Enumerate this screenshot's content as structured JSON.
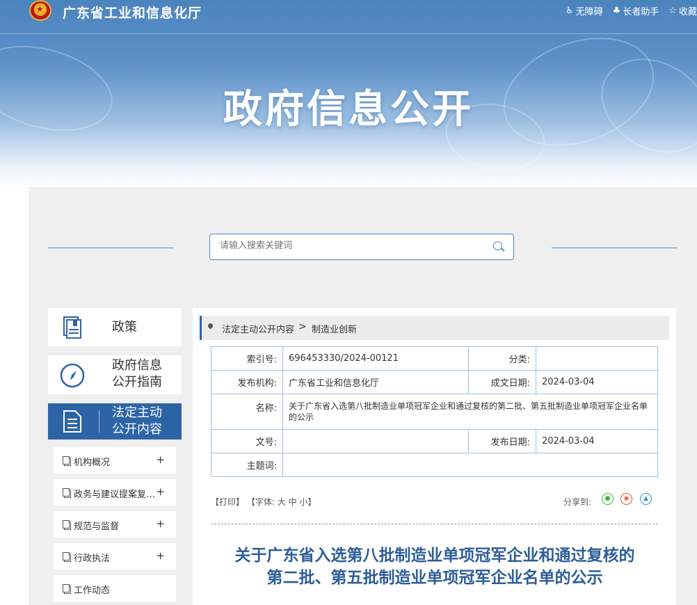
{
  "header": {
    "site_title": "广东省工业和信息化厅",
    "links": [
      {
        "label": "无障碍",
        "icon": "accessibility-icon"
      },
      {
        "label": "长者助手",
        "icon": "elder-helper-icon"
      },
      {
        "label": "收藏",
        "icon": "star-icon"
      }
    ],
    "hero_title": "政府信息公开"
  },
  "search": {
    "placeholder": "请输入搜索关键词"
  },
  "sidebar": {
    "cards": [
      {
        "label_line1": "政策",
        "label_line2": "",
        "icon": "book-icon"
      },
      {
        "label_line1": "政府信息",
        "label_line2": "公开指南",
        "icon": "compass-icon"
      },
      {
        "label_line1": "法定主动",
        "label_line2": "公开内容",
        "icon": "document-icon",
        "active": true
      }
    ],
    "items": [
      {
        "label": "机构概况",
        "expand": "+"
      },
      {
        "label": "政务与建议提案复…",
        "expand": "+"
      },
      {
        "label": "规范与监督",
        "expand": "+"
      },
      {
        "label": "行政执法",
        "expand": "+"
      },
      {
        "label": "工作动态",
        "expand": ""
      }
    ]
  },
  "breadcrumb": {
    "first": "法定主动公开内容",
    "separator": ">",
    "second": "制造业创新"
  },
  "meta": {
    "index_label": "索引号:",
    "index_value": "696453330/2024-00121",
    "category_label": "分类:",
    "category_value": "",
    "publisher_label": "发布机构:",
    "publisher_value": "广东省工业和信息化厅",
    "created_label": "成文日期:",
    "created_value": "2024-03-04",
    "name_label": "名称:",
    "name_value": "关于广东省入选第八批制造业单项冠军企业和通过复核的第二批、第五批制造业单项冠军企业名单的公示",
    "docno_label": "文号:",
    "docno_value": "",
    "published_label": "发布日期:",
    "published_value": "2024-03-04",
    "subject_label": "主题词:",
    "subject_value": ""
  },
  "tools": {
    "print": "【打印】",
    "font_label": "【字体:",
    "font_large": "大",
    "font_medium": "中",
    "font_small": "小】",
    "share_label": "分享到:"
  },
  "article": {
    "title_line1": "关于广东省入选第八批制造业单项冠军企业和通过复核的",
    "title_line2": "第二批、第五批制造业单项冠军企业名单的公示"
  },
  "colors": {
    "accent": "#2d64a6",
    "title_blue": "#2d5d99",
    "wechat": "#3db83a",
    "weibo": "#e2532d",
    "qq": "#3a8fd9"
  }
}
